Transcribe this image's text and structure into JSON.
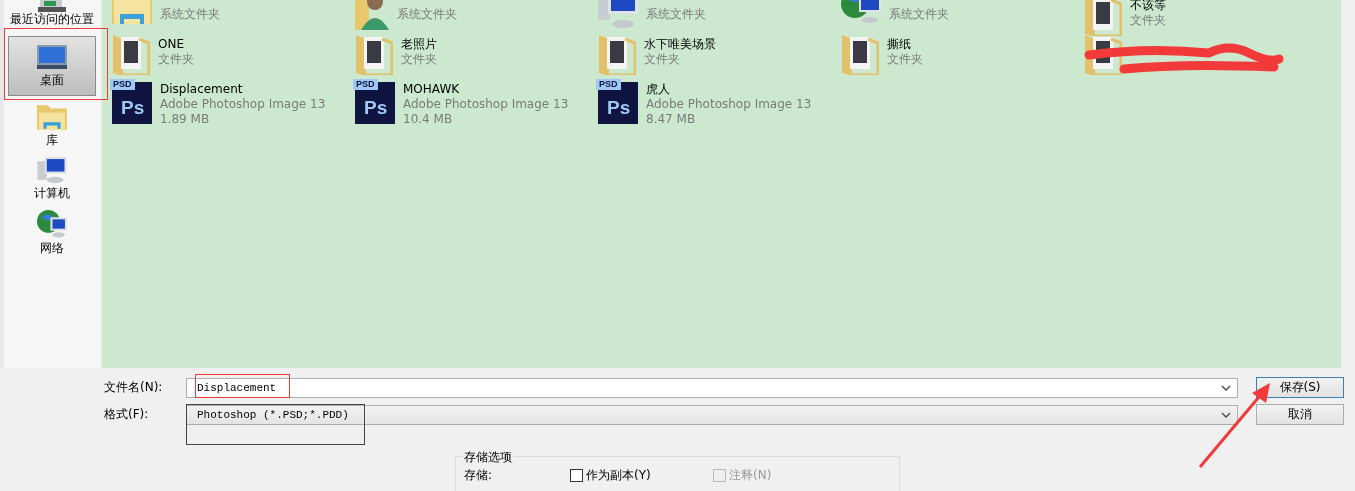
{
  "sidebar": {
    "items": [
      {
        "label": "最近访问的位置",
        "kind": "recent",
        "selected": false
      },
      {
        "label": "桌面",
        "kind": "desktop",
        "selected": true
      },
      {
        "label": "库",
        "kind": "library",
        "selected": false
      },
      {
        "label": "计算机",
        "kind": "computer",
        "selected": false
      },
      {
        "label": "网络",
        "kind": "network",
        "selected": false
      }
    ]
  },
  "files": [
    {
      "kind": "library",
      "type": "系统文件夹"
    },
    {
      "kind": "user",
      "type": "系统文件夹"
    },
    {
      "kind": "computer",
      "type": "系统文件夹"
    },
    {
      "kind": "network",
      "type": "系统文件夹"
    },
    {
      "kind": "folder",
      "name": "不该等",
      "type": "文件夹"
    },
    {
      "kind": "folder",
      "name": "ONE",
      "type": "文件夹"
    },
    {
      "kind": "folder",
      "name": "老照片",
      "type": "文件夹"
    },
    {
      "kind": "folder",
      "name": "水下唯美场景",
      "type": "文件夹"
    },
    {
      "kind": "folder",
      "name": "撕纸",
      "type": "文件夹"
    },
    {
      "kind": "folder",
      "redacted": true
    },
    {
      "kind": "psd",
      "badge": "PSD",
      "logo": "Ps",
      "name": "Displacement",
      "type": "Adobe Photoshop Image 13",
      "size": "1.89 MB"
    },
    {
      "kind": "psd",
      "badge": "PSD",
      "logo": "Ps",
      "name": "MOHAWK",
      "type": "Adobe Photoshop Image 13",
      "size": "10.4 MB"
    },
    {
      "kind": "psd",
      "badge": "PSD",
      "logo": "Ps",
      "name": "虎人",
      "type": "Adobe Photoshop Image 13",
      "size": "8.47 MB"
    }
  ],
  "filename": {
    "label": "文件名(N):",
    "value": "Displacement"
  },
  "format": {
    "label": "格式(F):",
    "value": "Photoshop (*.PSD;*.PDD)"
  },
  "buttons": [
    "保存(S)",
    "取消"
  ],
  "save_options": {
    "title": "存储选项",
    "label": "存储:",
    "checkboxes": [
      {
        "label": "作为副本(Y)",
        "checked": false,
        "disabled": false
      },
      {
        "label": "注释(N)",
        "checked": false,
        "disabled": true
      }
    ]
  }
}
